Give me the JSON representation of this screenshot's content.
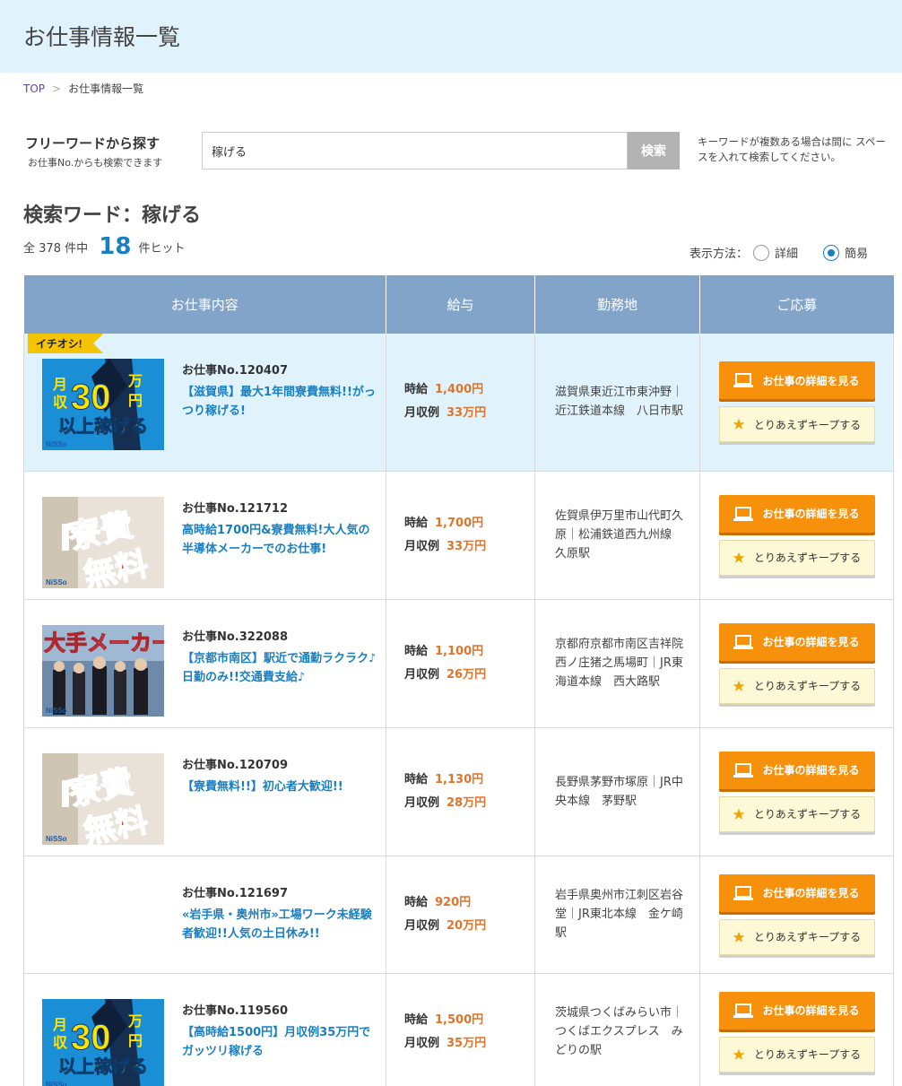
{
  "header": {
    "title": "お仕事情報一覧"
  },
  "breadcrumb": {
    "home": "TOP",
    "separator": ">",
    "current": "お仕事情報一覧"
  },
  "search": {
    "title": "フリーワードから探す",
    "subtitle": "お仕事No.からも検索できます",
    "value": "稼げる",
    "button": "検索",
    "note": "キーワードが複数ある場合は間に スペースを入れて検索してください。"
  },
  "results": {
    "heading": "検索ワード：稼げる",
    "total_prefix": "全",
    "total": "378",
    "total_suffix": "件中",
    "hits": "18",
    "hits_suffix": "件ヒット",
    "display_label": "表示方法：",
    "mode_detail": "詳細",
    "mode_simple": "簡易",
    "selected_mode": "簡易"
  },
  "table": {
    "headers": [
      "お仕事内容",
      "給与",
      "勤務地",
      "ご応募"
    ],
    "featured_badge": "イチオシ!",
    "wage_label": "時給",
    "monthly_label": "月収例",
    "detail_button": "お仕事の詳細を見る",
    "keep_button": "とりあえずキープする",
    "rows": [
      {
        "job_no": "お仕事No.120407",
        "title": "【滋賀県】最大1年間寮費無料!!がっつり稼げる!",
        "wage": "1,400円",
        "monthly": "33万円",
        "location": "滋賀県東近江市東沖野｜近江鉄道本線　八日市駅",
        "image": "monthly30",
        "featured": true
      },
      {
        "job_no": "お仕事No.121712",
        "title": "高時給1700円&寮費無料!大人気の半導体メーカーでのお仕事!",
        "wage": "1,700円",
        "monthly": "33万円",
        "location": "佐賀県伊万里市山代町久原｜松浦鉄道西九州線　久原駅",
        "image": "dorm-free",
        "featured": false
      },
      {
        "job_no": "お仕事No.322088",
        "title": "【京都市南区】駅近で通勤ラクラク♪日勤のみ!!交通費支給♪",
        "wage": "1,100円",
        "monthly": "26万円",
        "location": "京都府京都市南区吉祥院西ノ庄猪之馬場町｜JR東海道本線　西大路駅",
        "image": "maker",
        "featured": false
      },
      {
        "job_no": "お仕事No.120709",
        "title": "【寮費無料!!】初心者大歓迎!!",
        "wage": "1,130円",
        "monthly": "28万円",
        "location": "長野県茅野市塚原｜JR中央本線　茅野駅",
        "image": "dorm-free",
        "featured": false
      },
      {
        "job_no": "お仕事No.121697",
        "title": "«岩手県・奥州市»工場ワーク未経験者歓迎!!人気の土日休み!!",
        "wage": "920円",
        "monthly": "20万円",
        "location": "岩手県奥州市江刺区岩谷堂｜JR東北本線　金ケ崎駅",
        "image": "none",
        "featured": false
      },
      {
        "job_no": "お仕事No.119560",
        "title": "【高時給1500円】月収例35万円でガッツリ稼げる",
        "wage": "1,500円",
        "monthly": "35万円",
        "location": "茨城県つくばみらい市｜つくばエクスプレス　みどりの駅",
        "image": "monthly30",
        "featured": false
      }
    ]
  },
  "thumbs": {
    "monthly30": {
      "line1a": "月",
      "line1b": "収",
      "num": "30",
      "unit1": "万",
      "unit2": "円",
      "line2": "以上稼げる"
    },
    "dorm": {
      "line1": "寮費",
      "line2": "無料"
    },
    "maker": {
      "text": "大手メーカー"
    },
    "logo": "NiSSo"
  },
  "colors": {
    "accent": "#1a7fc1",
    "header_bg": "#e0f3fd",
    "table_head": "#83a4c9",
    "detail_btn": "#f7900a",
    "wage": "#e0742a"
  }
}
